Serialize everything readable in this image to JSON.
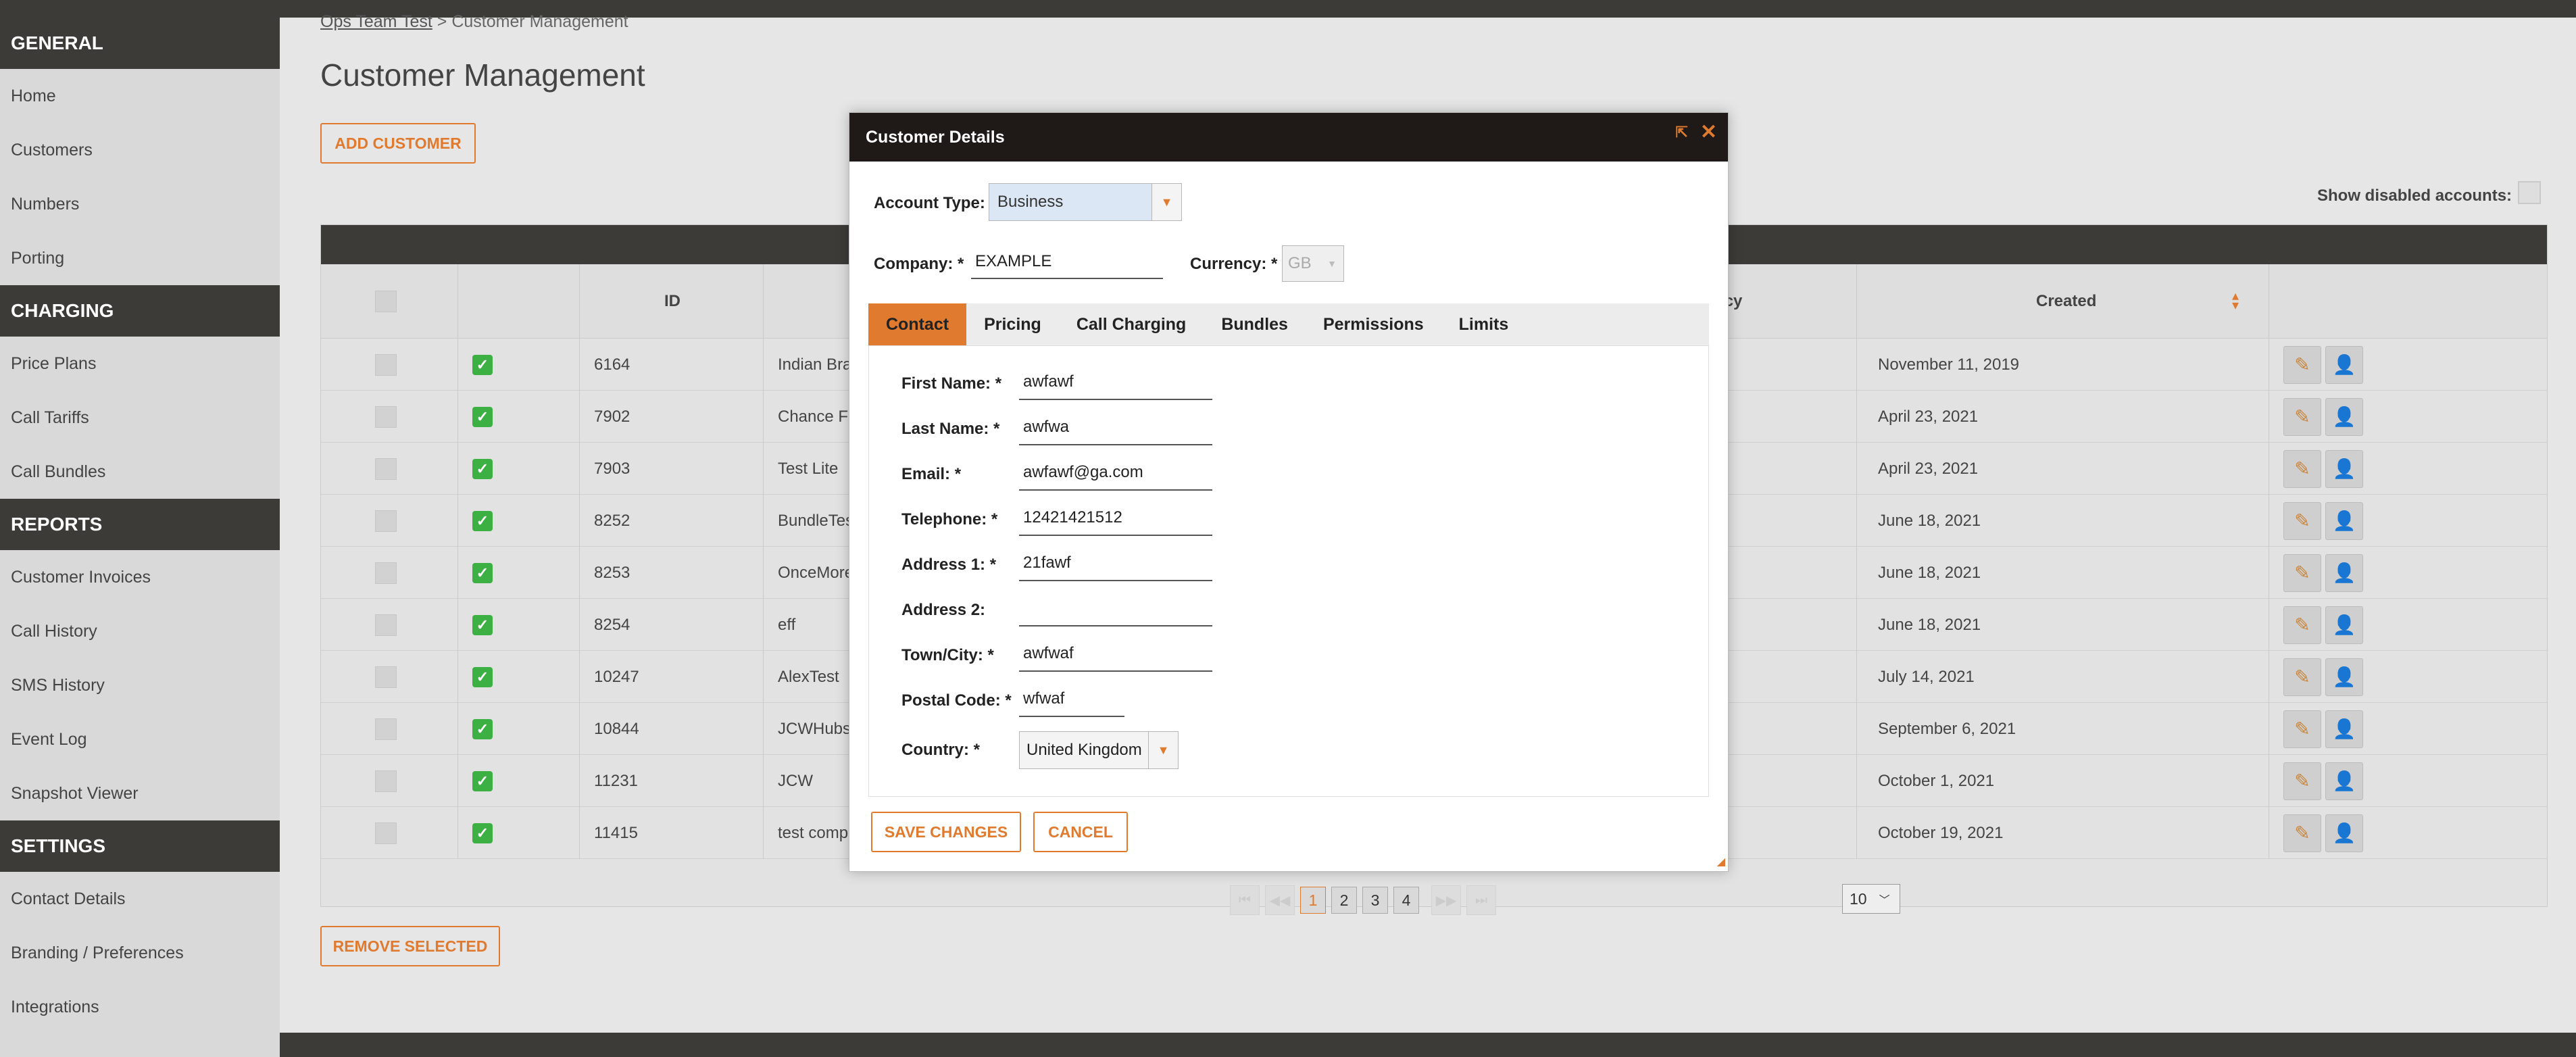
{
  "sidebar": {
    "sections": [
      {
        "header": "GENERAL",
        "items": [
          "Home",
          "Customers",
          "Numbers",
          "Porting"
        ]
      },
      {
        "header": "CHARGING",
        "items": [
          "Price Plans",
          "Call Tariffs",
          "Call Bundles"
        ]
      },
      {
        "header": "REPORTS",
        "items": [
          "Customer Invoices",
          "Call History",
          "SMS History",
          "Event Log",
          "Snapshot Viewer"
        ]
      },
      {
        "header": "SETTINGS",
        "items": [
          "Contact Details",
          "Branding / Preferences",
          "Integrations"
        ]
      }
    ]
  },
  "breadcrumb": {
    "parent": "Ops Team Test",
    "separator": ">",
    "current": "Customer Management"
  },
  "page": {
    "title": "Customer Management",
    "add_button": "ADD CUSTOMER",
    "remove_button": "REMOVE SELECTED",
    "show_disabled_label": "Show disabled accounts:"
  },
  "table": {
    "headers": {
      "id": "ID",
      "currency": "rrency",
      "created": "Created"
    },
    "rows": [
      {
        "id": "6164",
        "name": "Indian Bra",
        "created": "November 11, 2019"
      },
      {
        "id": "7902",
        "name": "Chance Fa",
        "created": "April 23, 2021"
      },
      {
        "id": "7903",
        "name": "Test Lite",
        "created": "April 23, 2021"
      },
      {
        "id": "8252",
        "name": "BundleTes",
        "created": "June 18, 2021"
      },
      {
        "id": "8253",
        "name": "OnceMore",
        "created": "June 18, 2021"
      },
      {
        "id": "8254",
        "name": "eff",
        "created": "June 18, 2021"
      },
      {
        "id": "10247",
        "name": "AlexTest",
        "created": "July 14, 2021"
      },
      {
        "id": "10844",
        "name": "JCWHubsp",
        "created": "September 6, 2021"
      },
      {
        "id": "11231",
        "name": "JCW",
        "created": "October 1, 2021"
      },
      {
        "id": "11415",
        "name": "test comp",
        "created": "October 19, 2021"
      }
    ]
  },
  "pager": {
    "pages": [
      "1",
      "2",
      "3",
      "4"
    ],
    "active_page": "1",
    "page_size": "10"
  },
  "modal": {
    "title": "Customer Details",
    "account_type_label": "Account Type:",
    "account_type_value": "Business",
    "company_label": "Company: *",
    "company_value": "EXAMPLE",
    "currency_label": "Currency: *",
    "currency_value": "GB",
    "tabs": [
      "Contact",
      "Pricing",
      "Call Charging",
      "Bundles",
      "Permissions",
      "Limits"
    ],
    "active_tab": "Contact",
    "fields": [
      {
        "label": "First Name: *",
        "value": "awfawf"
      },
      {
        "label": "Last Name: *",
        "value": "awfwa"
      },
      {
        "label": "Email: *",
        "value": "awfawf@ga.com"
      },
      {
        "label": "Telephone: *",
        "value": "12421421512"
      },
      {
        "label": "Address 1: *",
        "value": "21fawf"
      },
      {
        "label": "Address 2:",
        "value": ""
      },
      {
        "label": "Town/City: *",
        "value": "awfwaf"
      },
      {
        "label": "Postal Code: *",
        "value": "wfwaf"
      }
    ],
    "country_label": "Country: *",
    "country_value": "United Kingdom",
    "save_button": "SAVE CHANGES",
    "cancel_button": "CANCEL"
  },
  "colors": {
    "accent": "#e07a2e",
    "dark": "#3c3b37",
    "check": "#3cb043"
  }
}
